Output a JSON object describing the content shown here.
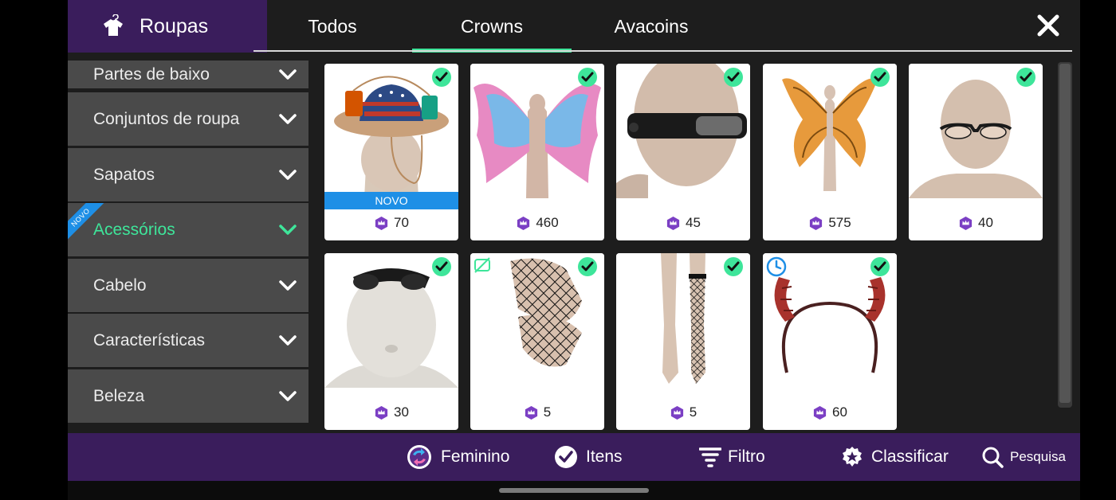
{
  "header": {
    "title": "Roupas",
    "title_icon": "shirt-hanger-icon",
    "tabs": [
      {
        "label": "Todos",
        "active": false
      },
      {
        "label": "Crowns",
        "active": true
      },
      {
        "label": "Avacoins",
        "active": false
      }
    ],
    "close_icon": "close-icon"
  },
  "sidebar": {
    "items": [
      {
        "label": "Partes de baixo",
        "active": false
      },
      {
        "label": "Conjuntos de roupa",
        "active": false
      },
      {
        "label": "Sapatos",
        "active": false
      },
      {
        "label": "Acessórios",
        "active": true,
        "badge": "NOVO"
      },
      {
        "label": "Cabelo",
        "active": false
      },
      {
        "label": "Características",
        "active": false
      },
      {
        "label": "Beleza",
        "active": false
      }
    ]
  },
  "items": [
    {
      "name": "patriotic cowboy hat",
      "price": "70",
      "badge": "NOVO",
      "owned": true
    },
    {
      "name": "pink fairy wings",
      "price": "460",
      "owned": true
    },
    {
      "name": "black sunglasses",
      "price": "45",
      "owned": true
    },
    {
      "name": "orange butterfly wings",
      "price": "575",
      "owned": true
    },
    {
      "name": "cat eye glasses",
      "price": "40",
      "owned": true
    },
    {
      "name": "sunglasses on head",
      "price": "30",
      "owned": true
    },
    {
      "name": "fishnet gloves",
      "price": "5",
      "owned": true,
      "hidden_icon": true
    },
    {
      "name": "fishnet stocking",
      "price": "5",
      "owned": true
    },
    {
      "name": "devil horns headband",
      "price": "60",
      "owned": false,
      "limited": true
    }
  ],
  "bottombar": {
    "gender": "Feminino",
    "items": "Itens",
    "filter": "Filtro",
    "sort": "Classificar",
    "search": "Pesquisa"
  },
  "colors": {
    "accent": "#3ee59a",
    "brand": "#3a1d5c",
    "novo_blue": "#1e8fe6",
    "gem_purple": "#7b3fc4"
  }
}
